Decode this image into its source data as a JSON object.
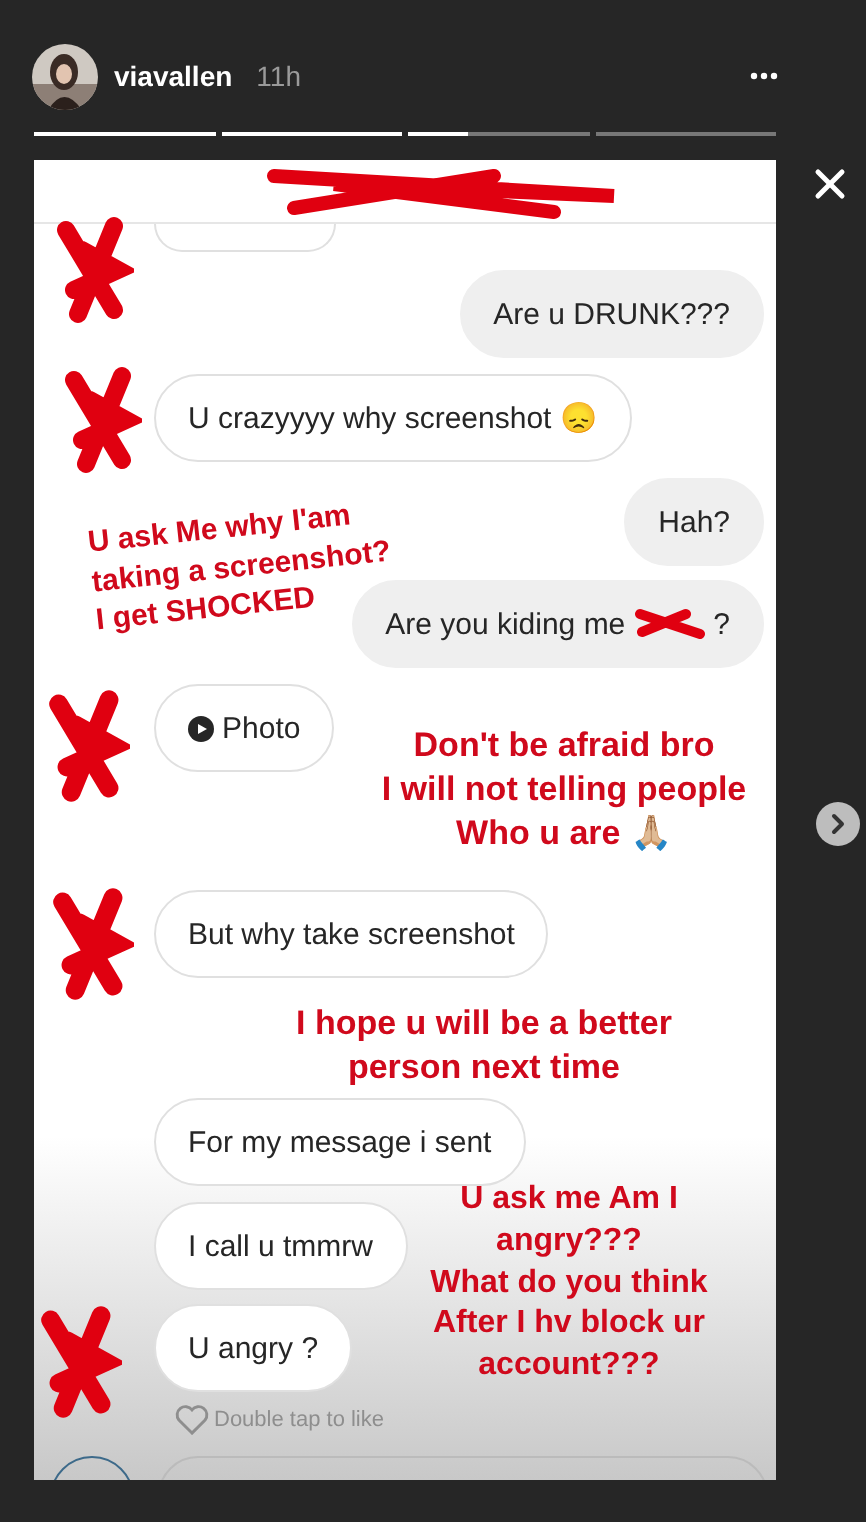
{
  "story": {
    "username": "viavallen",
    "time": "11h"
  },
  "messages": [
    {
      "outgoing": false,
      "kind": "cut"
    },
    {
      "outgoing": true,
      "kind": "text",
      "text": "Are u DRUNK???"
    },
    {
      "outgoing": false,
      "kind": "text",
      "text": "U crazyyyy why screenshot 😞"
    },
    {
      "outgoing": true,
      "kind": "text",
      "text": "Hah?"
    },
    {
      "outgoing": true,
      "kind": "redacted",
      "text": "Are you kiding me",
      "tail": "?"
    },
    {
      "outgoing": false,
      "text": "Photo"
    },
    {
      "outgoing": false,
      "kind": "text",
      "text": "But why take screenshot"
    },
    {
      "outgoing": false,
      "kind": "text",
      "text": "For my message i sent"
    },
    {
      "outgoing": false,
      "kind": "text",
      "text": "I call u tmmrw"
    },
    {
      "outgoing": false,
      "kind": "text",
      "text": "U angry ?"
    }
  ],
  "like_hint": "Double tap to like",
  "annotations": [
    {
      "text": "U ask Me why I'am\ntaking a screenshot?\nI get SHOCKED"
    },
    {
      "text": "Don't be afraid bro\nI will not telling people\nWho u are 🙏🏼"
    },
    {
      "text": "I hope u will be a better\nperson next time"
    },
    {
      "text": "U ask me Am I\nangry???\nWhat do you think\nAfter I hv block ur\naccount???"
    }
  ]
}
